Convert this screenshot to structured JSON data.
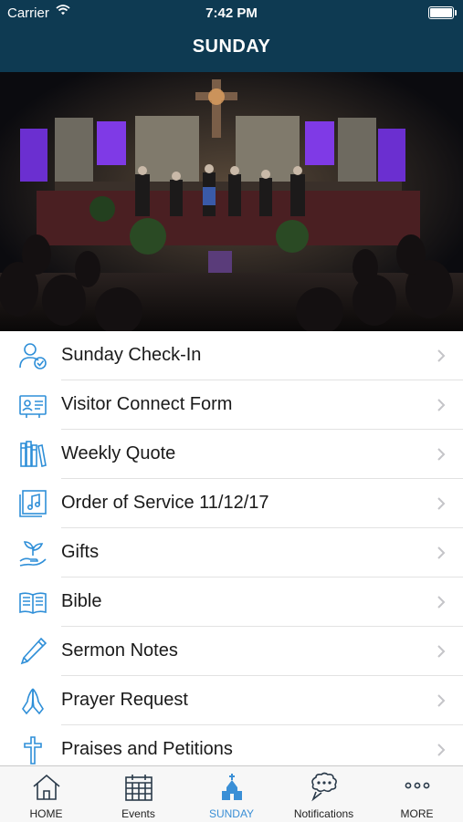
{
  "status": {
    "carrier": "Carrier",
    "time": "7:42 PM"
  },
  "header": {
    "title": "SUNDAY"
  },
  "menu": [
    {
      "label": "Sunday Check-In",
      "icon": "person-check-icon"
    },
    {
      "label": "Visitor Connect Form",
      "icon": "id-card-icon"
    },
    {
      "label": "Weekly Quote",
      "icon": "books-icon"
    },
    {
      "label": "Order of Service 11/12/17",
      "icon": "music-note-icon"
    },
    {
      "label": "Gifts",
      "icon": "hand-plant-icon"
    },
    {
      "label": "Bible",
      "icon": "open-book-icon"
    },
    {
      "label": "Sermon Notes",
      "icon": "pen-icon"
    },
    {
      "label": "Prayer Request",
      "icon": "praying-hands-icon"
    },
    {
      "label": "Praises and Petitions",
      "icon": "cross-icon"
    }
  ],
  "tabs": [
    {
      "label": "HOME",
      "icon": "home-icon"
    },
    {
      "label": "Events",
      "icon": "calendar-icon"
    },
    {
      "label": "SUNDAY",
      "icon": "church-icon",
      "active": true
    },
    {
      "label": "Notifications",
      "icon": "speech-bubble-icon"
    },
    {
      "label": "MORE",
      "icon": "more-dots-icon"
    }
  ],
  "colors": {
    "header": "#0e3a52",
    "accent": "#3a8fd6",
    "icon": "#2f8fd8"
  }
}
